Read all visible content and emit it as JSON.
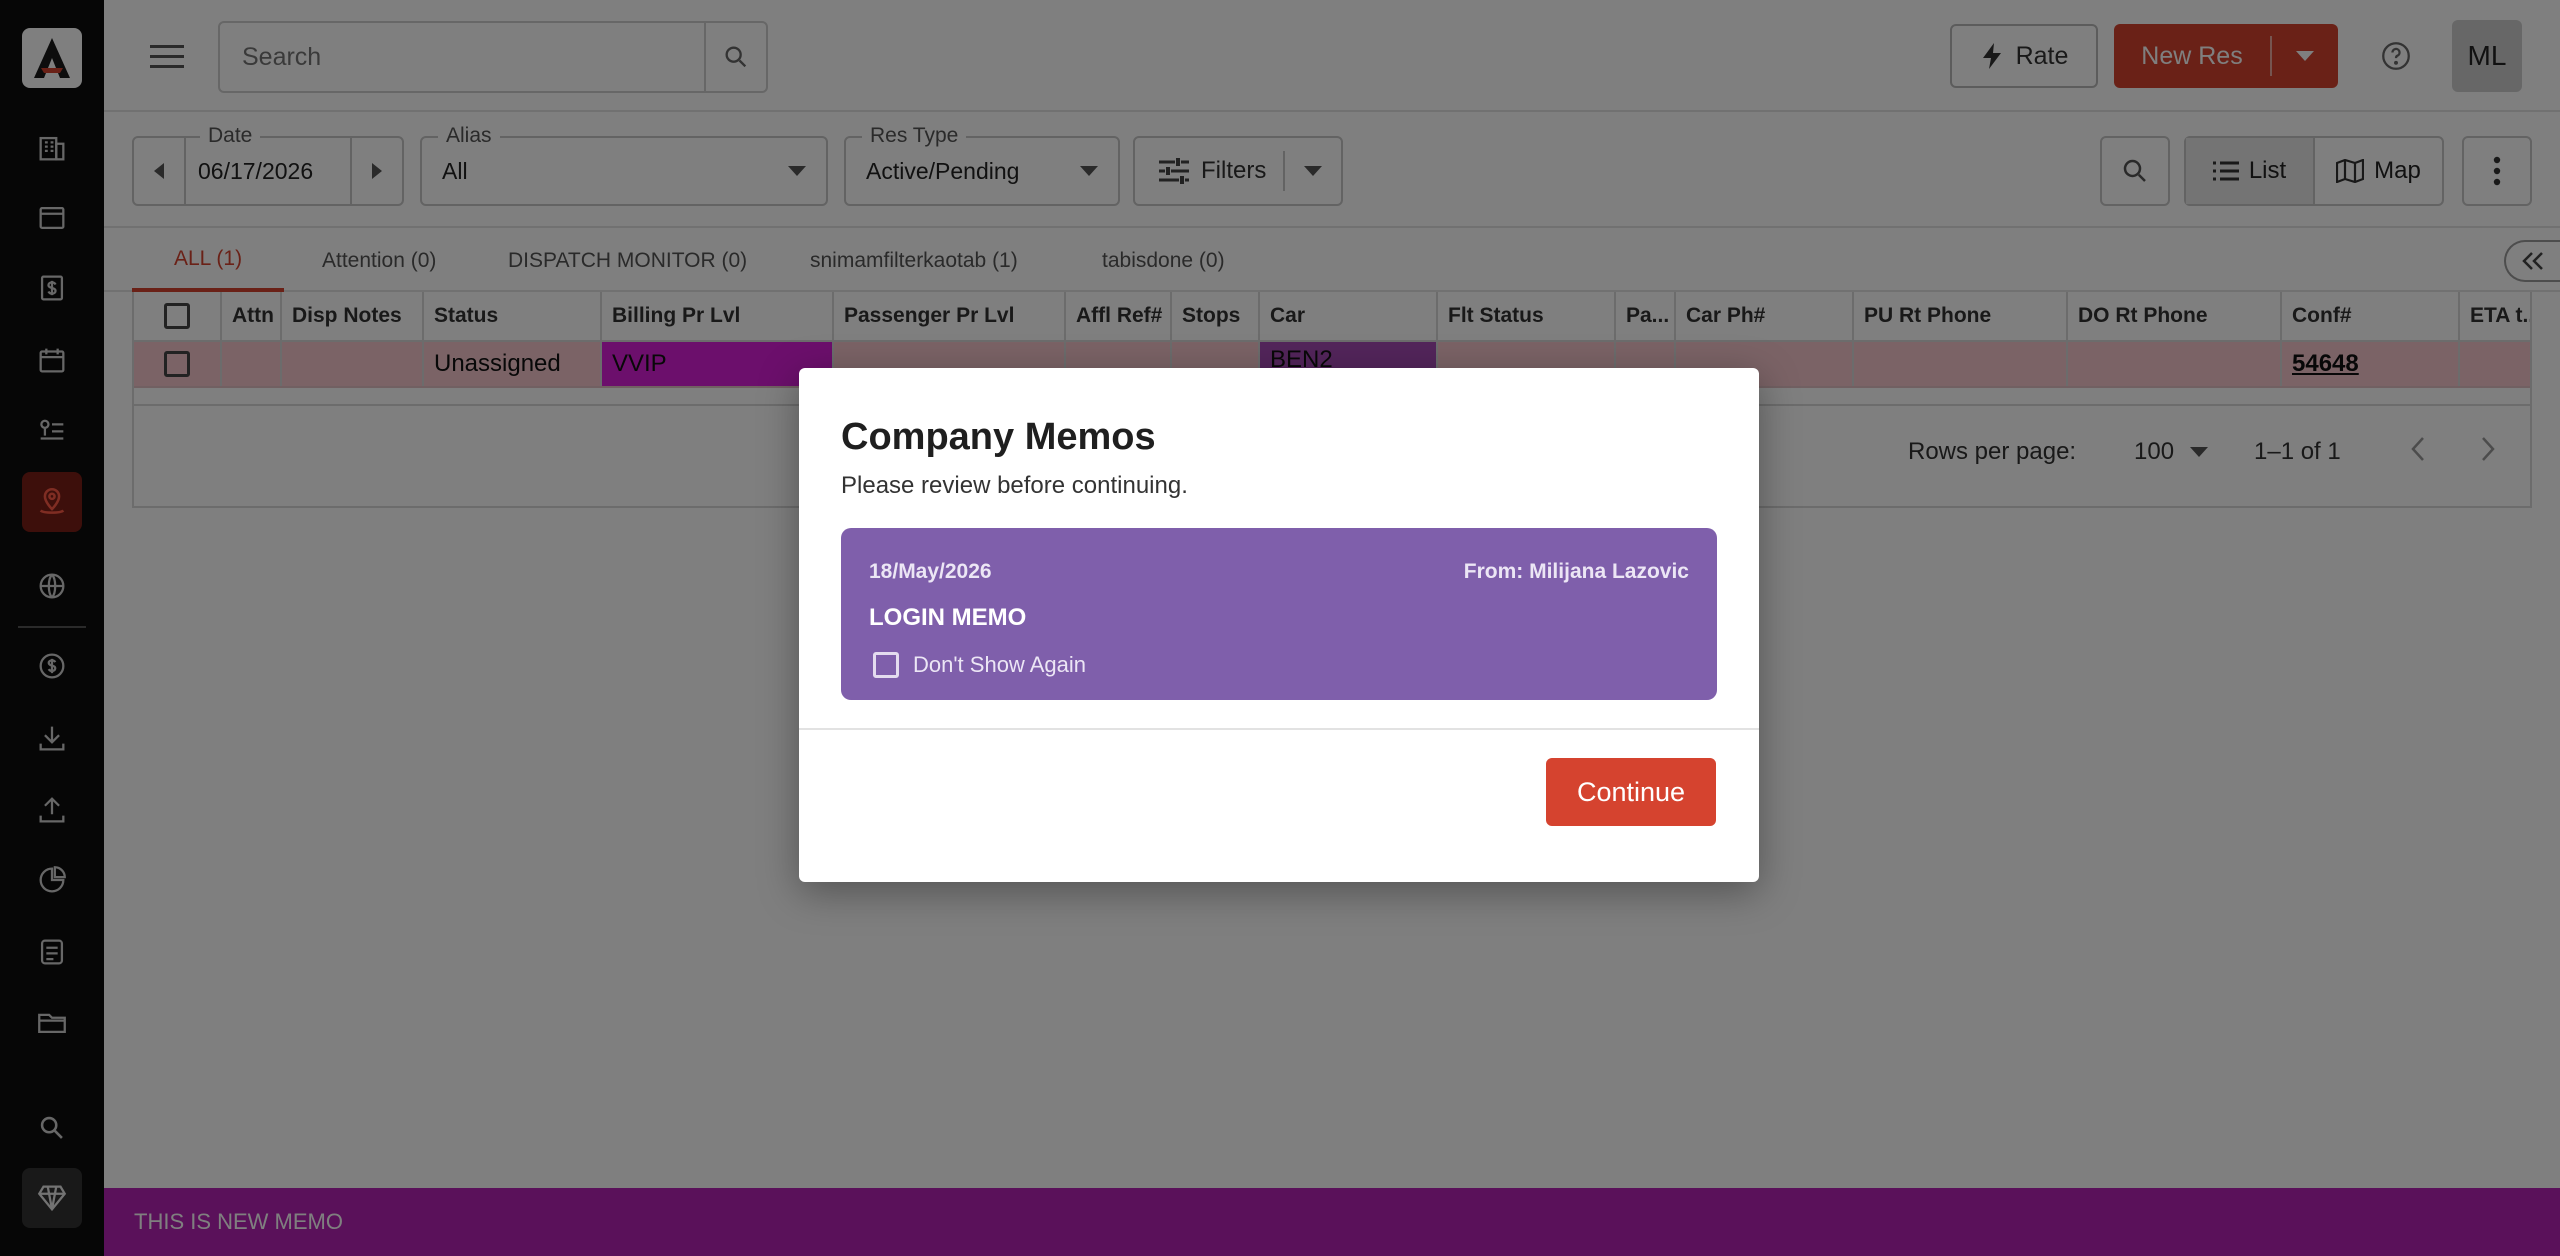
{
  "rail": {
    "items": [
      "corporate-icon",
      "inbox-icon",
      "billing-icon",
      "calendar-icon",
      "dispatch-list-icon",
      "dispatch-map-icon",
      "globe-icon",
      "finance-icon",
      "download-icon",
      "upload-icon",
      "reports-icon",
      "document-icon",
      "folder-icon",
      "search-icon",
      "premium-icon"
    ],
    "active_color": "#7a1e16"
  },
  "header": {
    "search_placeholder": "Search",
    "rate_label": "Rate",
    "new_res_label": "New Res",
    "avatar_initials": "ML",
    "accent_color": "#d5432f"
  },
  "filters": {
    "date_label": "Date",
    "date_value": "06/17/2026",
    "alias_label": "Alias",
    "alias_value": "All",
    "res_type_label": "Res Type",
    "res_type_value": "Active/Pending",
    "filters_label": "Filters",
    "list_label": "List",
    "map_label": "Map"
  },
  "tabs": [
    {
      "label": "ALL (1)"
    },
    {
      "label": "Attention (0)"
    },
    {
      "label": "DISPATCH MONITOR (0)"
    },
    {
      "label": "snimamfilterkaotab (1)"
    },
    {
      "label": "tabisdone (0)"
    }
  ],
  "table": {
    "columns": [
      "Attn",
      "Disp Notes",
      "Status",
      "Billing Pr Lvl",
      "Passenger Pr Lvl",
      "Affl Ref#",
      "Stops",
      "Car",
      "Flt Status",
      "Pa...",
      "Car Ph#",
      "PU Rt Phone",
      "DO Rt Phone",
      "Conf#",
      "ETA t..."
    ],
    "row": {
      "status": "Unassigned",
      "billing_pr_lvl": "VVIP",
      "car": "BEN2",
      "conf": "54648"
    },
    "rows_per_page_label": "Rows per page:",
    "rows_per_page_value": "100",
    "range": "1–1 of 1"
  },
  "dialog": {
    "title": "Company Memos",
    "subtitle": "Please review before continuing.",
    "memo": {
      "date": "18/May/2026",
      "from": "From: Milijana Lazovic",
      "title": "LOGIN MEMO",
      "dont_show_again": "Don't Show Again",
      "color": "#7f5fab"
    },
    "continue_label": "Continue"
  },
  "memo_bar": {
    "text": "THIS IS NEW MEMO",
    "color": "#b523b5"
  }
}
